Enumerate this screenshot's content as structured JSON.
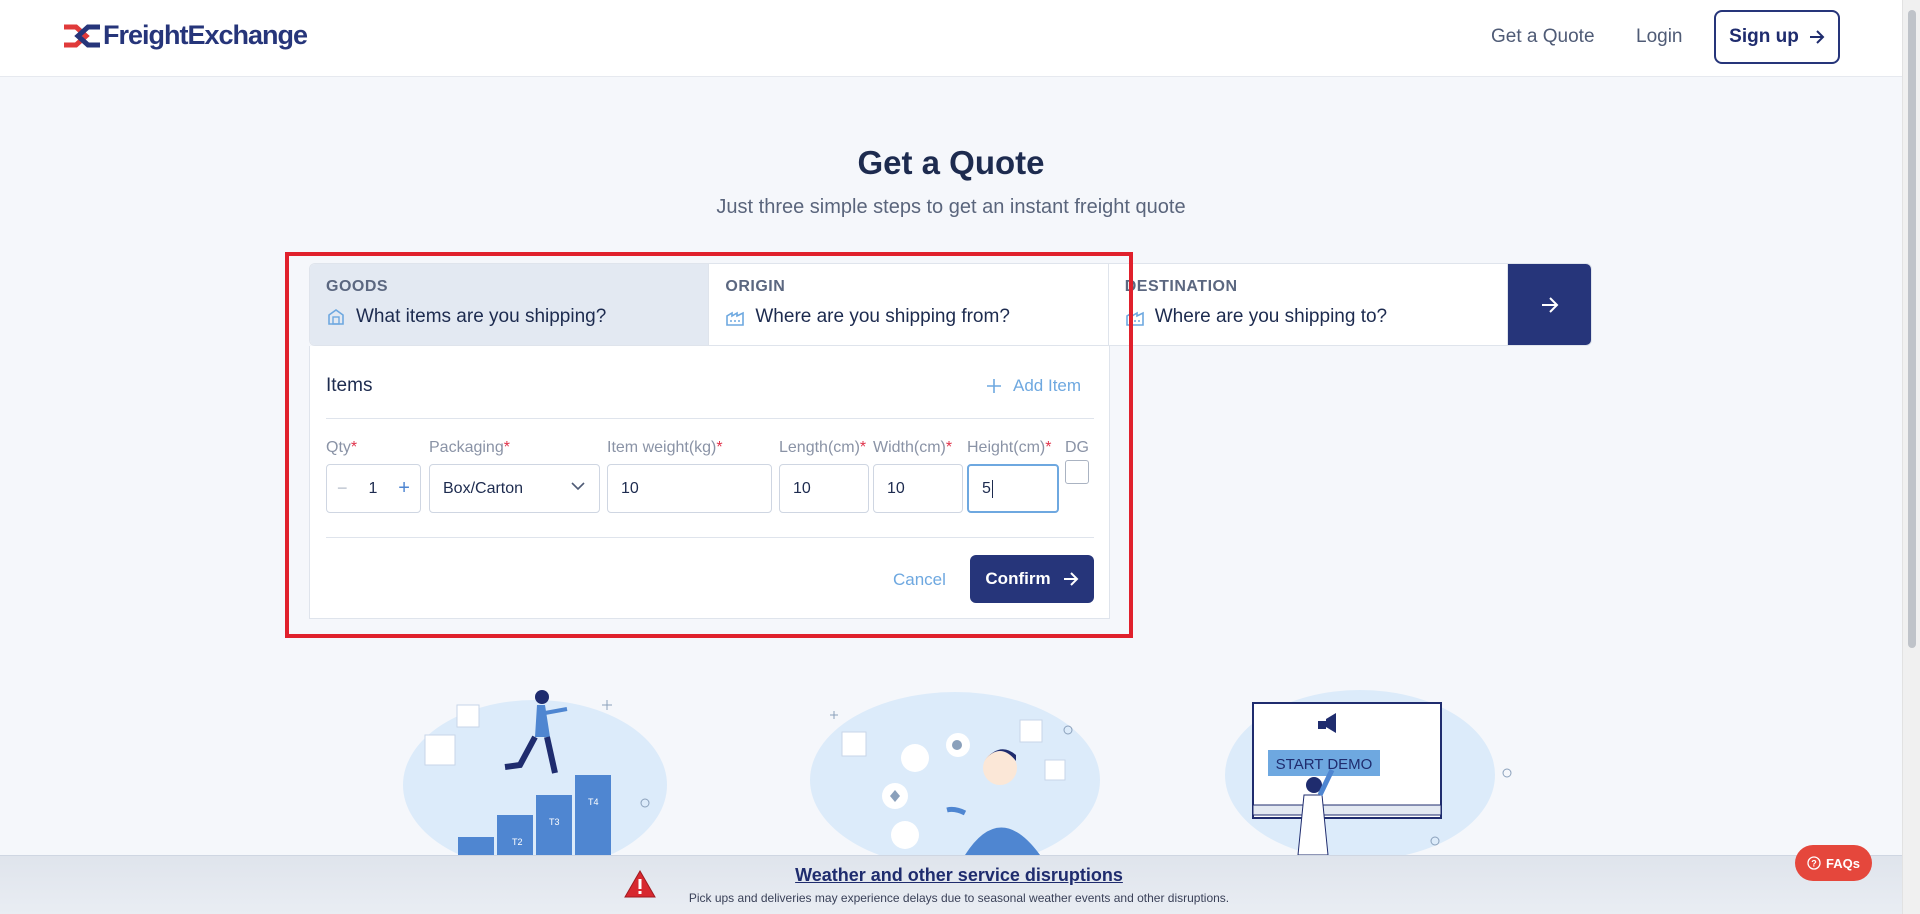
{
  "header": {
    "logo_text": "FreightExchange",
    "nav": {
      "get_quote": "Get a Quote",
      "login": "Login",
      "signup": "Sign up"
    }
  },
  "hero": {
    "title": "Get a Quote",
    "subtitle": "Just three simple steps to get an instant freight quote"
  },
  "steps": [
    {
      "label": "GOODS",
      "question": "What items are you shipping?",
      "icon": "package-icon",
      "active": true
    },
    {
      "label": "ORIGIN",
      "question": "Where are you shipping from?",
      "icon": "warehouse-icon",
      "active": false
    },
    {
      "label": "DESTINATION",
      "question": "Where are you shipping to?",
      "icon": "warehouse-icon",
      "active": false
    }
  ],
  "goods_form": {
    "items_title": "Items",
    "add_item_label": "Add Item",
    "labels": {
      "qty": "Qty",
      "packaging": "Packaging",
      "weight": "Item weight(kg)",
      "length": "Length(cm)",
      "width": "Width(cm)",
      "height": "Height(cm)",
      "dg": "DG"
    },
    "required_mark": "*",
    "values": {
      "qty": "1",
      "packaging": "Box/Carton",
      "weight": "10",
      "length": "10",
      "width": "10",
      "height": "5"
    },
    "cancel_label": "Cancel",
    "confirm_label": "Confirm"
  },
  "illustrations": {
    "stairs_labels": [
      "T2",
      "T3",
      "T4"
    ],
    "demo_sign": "START DEMO"
  },
  "banner": {
    "title": "Weather and other service disruptions",
    "text": "Pick ups and deliveries may experience delays due to seasonal weather events and other disruptions."
  },
  "faq_label": "FAQs",
  "colors": {
    "brand_navy": "#26357a",
    "accent_red": "#e5473c",
    "link_blue": "#6ea8e0",
    "highlight_red": "#e0202c"
  }
}
